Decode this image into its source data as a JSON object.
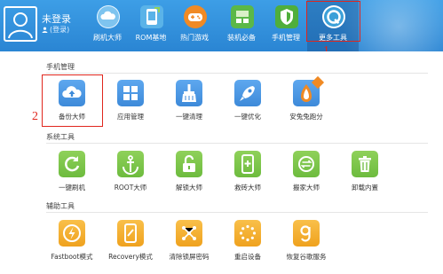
{
  "user": {
    "name": "未登录",
    "login": "(登录)"
  },
  "nav": [
    {
      "label": "刷机大师",
      "icon": "cloud-icon",
      "color": "#4ab1ea"
    },
    {
      "label": "ROM基地",
      "icon": "rom-icon",
      "color": "#4ab1ea"
    },
    {
      "label": "热门游戏",
      "icon": "gamepad-icon",
      "color": "#f08a24"
    },
    {
      "label": "装机必备",
      "icon": "apps-icon",
      "color": "#5bb848"
    },
    {
      "label": "手机管理",
      "icon": "shield-icon",
      "color": "#5bb848"
    },
    {
      "label": "更多工具",
      "icon": "tools-icon",
      "color": "#3ca0d8"
    }
  ],
  "annotations": {
    "one": "1",
    "two": "2"
  },
  "sections": [
    {
      "title": "手机管理",
      "items": [
        {
          "label": "备份大师",
          "icon": "cloud-upload-icon"
        },
        {
          "label": "应用管理",
          "icon": "app-grid-icon"
        },
        {
          "label": "一键清理",
          "icon": "broom-icon"
        },
        {
          "label": "一键优化",
          "icon": "rocket-icon"
        },
        {
          "label": "安兔兔跑分",
          "icon": "antutu-icon"
        }
      ]
    },
    {
      "title": "系统工具",
      "items": [
        {
          "label": "一键刷机",
          "icon": "refresh-icon"
        },
        {
          "label": "ROOT大师",
          "icon": "anchor-icon"
        },
        {
          "label": "解锁大师",
          "icon": "unlock-icon"
        },
        {
          "label": "救砖大师",
          "icon": "phone-plus-icon"
        },
        {
          "label": "搬家大师",
          "icon": "transfer-icon"
        },
        {
          "label": "卸载内置",
          "icon": "trash-icon"
        }
      ]
    },
    {
      "title": "辅助工具",
      "items": [
        {
          "label": "Fastboot模式",
          "icon": "lightning-icon"
        },
        {
          "label": "Recovery模式",
          "icon": "recovery-icon"
        },
        {
          "label": "清除锁屏密码",
          "icon": "pattern-lock-icon"
        },
        {
          "label": "重启设备",
          "icon": "restart-icon"
        },
        {
          "label": "恢复谷歌服务",
          "icon": "google-icon"
        }
      ]
    }
  ]
}
